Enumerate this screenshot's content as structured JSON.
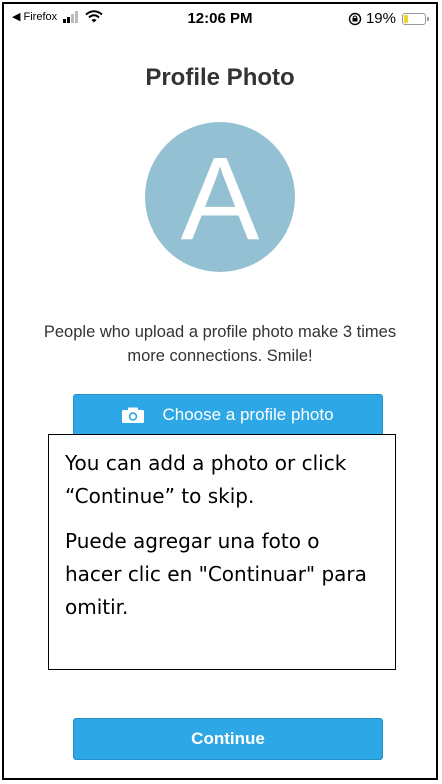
{
  "status_bar": {
    "back_label": "◀ Firefox",
    "time": "12:06 PM",
    "battery_percent": "19%",
    "battery_level": 0.19,
    "icons": [
      "signal-icon",
      "wifi-icon",
      "rotation-lock-icon",
      "battery-icon"
    ]
  },
  "page": {
    "title": "Profile Photo",
    "avatar_letter": "A",
    "promo_text": "People who upload a profile photo make 3 times more connections. Smile!"
  },
  "buttons": {
    "choose_photo": "Choose a profile photo",
    "continue": "Continue"
  },
  "overlay": {
    "english": "You can add a photo or click “Continue” to skip.",
    "spanish": "Puede agregar una foto o hacer clic en \"Continuar\" para omitir."
  },
  "colors": {
    "accent": "#2ea7e6",
    "avatar_bg": "#93c1d3",
    "battery": "#f5d22a"
  }
}
